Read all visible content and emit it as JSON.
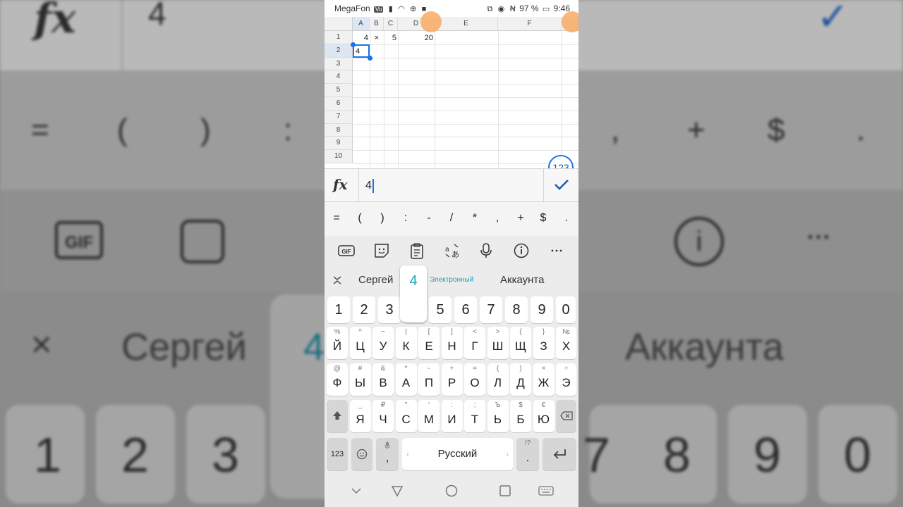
{
  "status": {
    "carrier": "MegaFon",
    "battery": "97 %",
    "time": "9:46"
  },
  "sheet": {
    "columns": [
      "A",
      "B",
      "C",
      "D",
      "E",
      "F"
    ],
    "rows": [
      "1",
      "2",
      "3",
      "4",
      "5",
      "6",
      "7",
      "8",
      "9",
      "10"
    ],
    "cells": {
      "A1": "4",
      "B1": "×",
      "C1": "5",
      "D1": "20",
      "A2": "4"
    },
    "fab_label": "123"
  },
  "formula_bar": {
    "fx_label": "fx",
    "value": "4"
  },
  "symbols": [
    "=",
    "(",
    ")",
    ":",
    "-",
    "/",
    "*",
    ",",
    "+",
    "$",
    "."
  ],
  "suggestions": {
    "left": "Сергей",
    "popup": "4",
    "middle": "Электронный",
    "right": "Аккаунта"
  },
  "keyboard": {
    "numbers": [
      "1",
      "2",
      "3",
      "4",
      "5",
      "6",
      "7",
      "8",
      "9",
      "0"
    ],
    "row1": [
      {
        "sub": "%",
        "main": "Й"
      },
      {
        "sub": "^",
        "main": "Ц"
      },
      {
        "sub": "~",
        "main": "У"
      },
      {
        "sub": "|",
        "main": "К"
      },
      {
        "sub": "[",
        "main": "Е"
      },
      {
        "sub": "]",
        "main": "Н"
      },
      {
        "sub": "<",
        "main": "Г"
      },
      {
        "sub": ">",
        "main": "Ш"
      },
      {
        "sub": "{",
        "main": "Щ"
      },
      {
        "sub": "}",
        "main": "З"
      },
      {
        "sub": "№",
        "main": "Х"
      }
    ],
    "row2": [
      {
        "sub": "@",
        "main": "Ф"
      },
      {
        "sub": "#",
        "main": "Ы"
      },
      {
        "sub": "&",
        "main": "В"
      },
      {
        "sub": "*",
        "main": "А"
      },
      {
        "sub": "-",
        "main": "П"
      },
      {
        "sub": "+",
        "main": "Р"
      },
      {
        "sub": "=",
        "main": "О"
      },
      {
        "sub": "(",
        "main": "Л"
      },
      {
        "sub": ")",
        "main": "Д"
      },
      {
        "sub": "×",
        "main": "Ж"
      },
      {
        "sub": "÷",
        "main": "Э"
      }
    ],
    "row3": [
      {
        "sub": "_",
        "main": "Я"
      },
      {
        "sub": "₽",
        "main": "Ч"
      },
      {
        "sub": "\"",
        "main": "С"
      },
      {
        "sub": "'",
        "main": "М"
      },
      {
        "sub": ":",
        "main": "И"
      },
      {
        "sub": ";",
        "main": "Т"
      },
      {
        "sub": "Ъ",
        "main": "Ь"
      },
      {
        "sub": "$",
        "main": "Б"
      },
      {
        "sub": "€",
        "main": "Ю"
      }
    ],
    "mode_label": "123",
    "comma": ",",
    "space_label": "Русский",
    "period": ".",
    "period_sub": "!?"
  },
  "background": {
    "fx": "fx",
    "value": "4",
    "symbols": [
      "=",
      "(",
      ")",
      ":",
      ",",
      "+",
      "$",
      "."
    ],
    "sugg_left": "Сергей",
    "sugg_pop": "4",
    "sugg_right": "Аккаунта",
    "keys_left": [
      "1",
      "2",
      "3"
    ],
    "keys_right": [
      "7",
      "8",
      "9",
      "0"
    ]
  }
}
